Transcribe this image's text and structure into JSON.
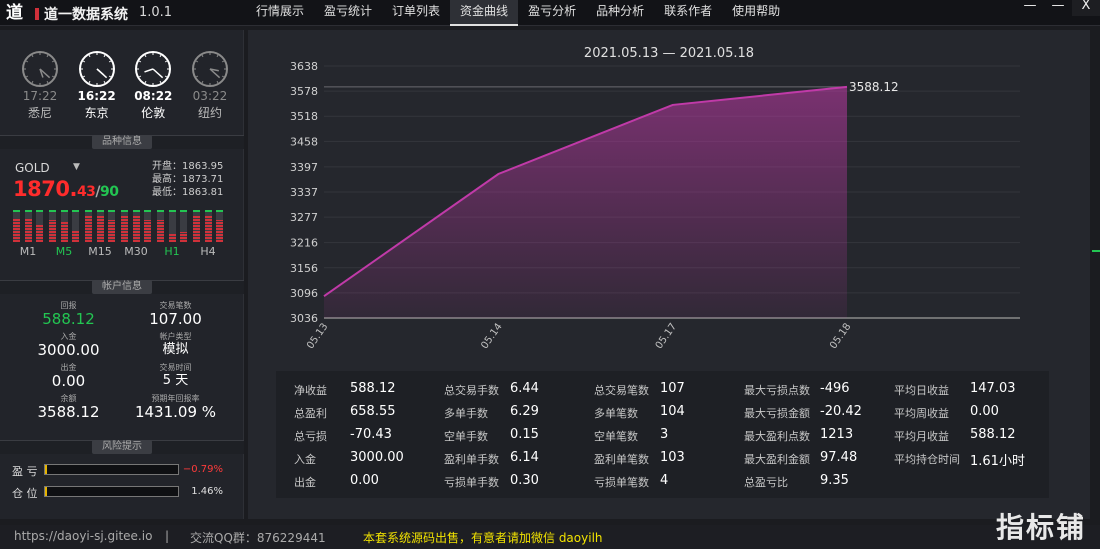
{
  "app": {
    "title": "道一数据系统",
    "version": "1.0.1"
  },
  "nav": [
    "行情展示",
    "盈亏统计",
    "订单列表",
    "资金曲线",
    "盈亏分析",
    "品种分析",
    "联系作者",
    "使用帮助"
  ],
  "nav_active": 3,
  "window": {
    "minimize": "—",
    "restore": "—",
    "close": "X"
  },
  "clocks": [
    {
      "time": "17:22",
      "city": "悉尼",
      "hour": 17,
      "minute": 22,
      "active": false
    },
    {
      "time": "16:22",
      "city": "东京",
      "hour": 16,
      "minute": 22,
      "active": true
    },
    {
      "time": "08:22",
      "city": "伦敦",
      "hour": 8,
      "minute": 22,
      "active": true
    },
    {
      "time": "03:22",
      "city": "纽约",
      "hour": 3,
      "minute": 22,
      "active": false
    }
  ],
  "sections": {
    "product": "品种信息",
    "account": "帐户信息",
    "risk": "风险提示"
  },
  "product": {
    "symbol": "GOLD",
    "price_main": "1870.",
    "price_tail": "43",
    "price_sep": "/",
    "price_green": "90",
    "open": "开盘：1863.95",
    "high": "最高：1873.71",
    "low": "最低：1863.81"
  },
  "timeframes": [
    {
      "label": "M1",
      "green": false,
      "levels": [
        0.75,
        0.75,
        0.55
      ]
    },
    {
      "label": "M5",
      "green": true,
      "levels": [
        0.7,
        0.65,
        0.35
      ]
    },
    {
      "label": "M15",
      "green": false,
      "levels": [
        0.8,
        0.8,
        0.7
      ]
    },
    {
      "label": "M30",
      "green": false,
      "levels": [
        0.85,
        0.8,
        0.7
      ]
    },
    {
      "label": "H1",
      "green": true,
      "levels": [
        0.7,
        0.25,
        0.3
      ]
    },
    {
      "label": "H4",
      "green": false,
      "levels": [
        0.8,
        0.8,
        0.7
      ]
    }
  ],
  "account": {
    "return_label": "回报",
    "return_value": "588.12",
    "trades_label": "交易笔数",
    "trades_value": "107.00",
    "deposit_label": "入金",
    "deposit_value": "3000.00",
    "type_label": "帐户类型",
    "type_value": "模拟",
    "withdraw_label": "出金",
    "withdraw_value": "0.00",
    "days_label": "交易时间",
    "days_value": "5 天",
    "balance_label": "余额",
    "balance_value": "3588.12",
    "annual_label": "预期年回报率",
    "annual_value": "1431.09 %"
  },
  "risk": [
    {
      "label": "盈 亏",
      "value": "−0.79%",
      "fill": 0.01,
      "color": "#ff3b3b"
    },
    {
      "label": "仓 位",
      "value": "1.46%",
      "fill": 0.015,
      "color": "#e0e0e0"
    }
  ],
  "chart_data": {
    "type": "area",
    "title": "2021.05.13 — 2021.05.18",
    "categories": [
      "05.13",
      "05.14",
      "05.17",
      "05.18"
    ],
    "values": [
      3088.0,
      3380.0,
      3545.0,
      3588.12
    ],
    "end_label": "3588.12",
    "y_ticks": [
      3036,
      3096,
      3156,
      3216,
      3277,
      3337,
      3397,
      3458,
      3518,
      3578,
      3638
    ],
    "ylim": [
      3036,
      3638
    ],
    "color": "#c03aa8"
  },
  "stats": [
    [
      "净收益",
      "588.12"
    ],
    [
      "总盈利",
      "658.55"
    ],
    [
      "总亏损",
      "-70.43"
    ],
    [
      "入金",
      "3000.00"
    ],
    [
      "出金",
      "0.00"
    ],
    [
      "总交易手数",
      "6.44"
    ],
    [
      "多单手数",
      "6.29"
    ],
    [
      "空单手数",
      "0.15"
    ],
    [
      "盈利单手数",
      "6.14"
    ],
    [
      "亏损单手数",
      "0.30"
    ],
    [
      "总交易笔数",
      "107"
    ],
    [
      "多单笔数",
      "104"
    ],
    [
      "空单笔数",
      "3"
    ],
    [
      "盈利单笔数",
      "103"
    ],
    [
      "亏损单笔数",
      "4"
    ],
    [
      "最大亏损点数",
      "-496"
    ],
    [
      "最大亏损金额",
      "-20.42"
    ],
    [
      "最大盈利点数",
      "1213"
    ],
    [
      "最大盈利金额",
      "97.48"
    ],
    [
      "总盈亏比",
      "9.35"
    ],
    [
      "平均日收益",
      "147.03"
    ],
    [
      "平均周收益",
      "0.00"
    ],
    [
      "平均月收益",
      "588.12"
    ],
    [
      "平均持仓时间",
      "1.61小时"
    ]
  ],
  "footer": {
    "url": "https://daoyi-sj.gitee.io",
    "sep": "|",
    "qq": "交流QQ群：876229441",
    "notice": "本套系统源码出售，有意者请加微信 daoyilh"
  },
  "watermark": "指标铺"
}
